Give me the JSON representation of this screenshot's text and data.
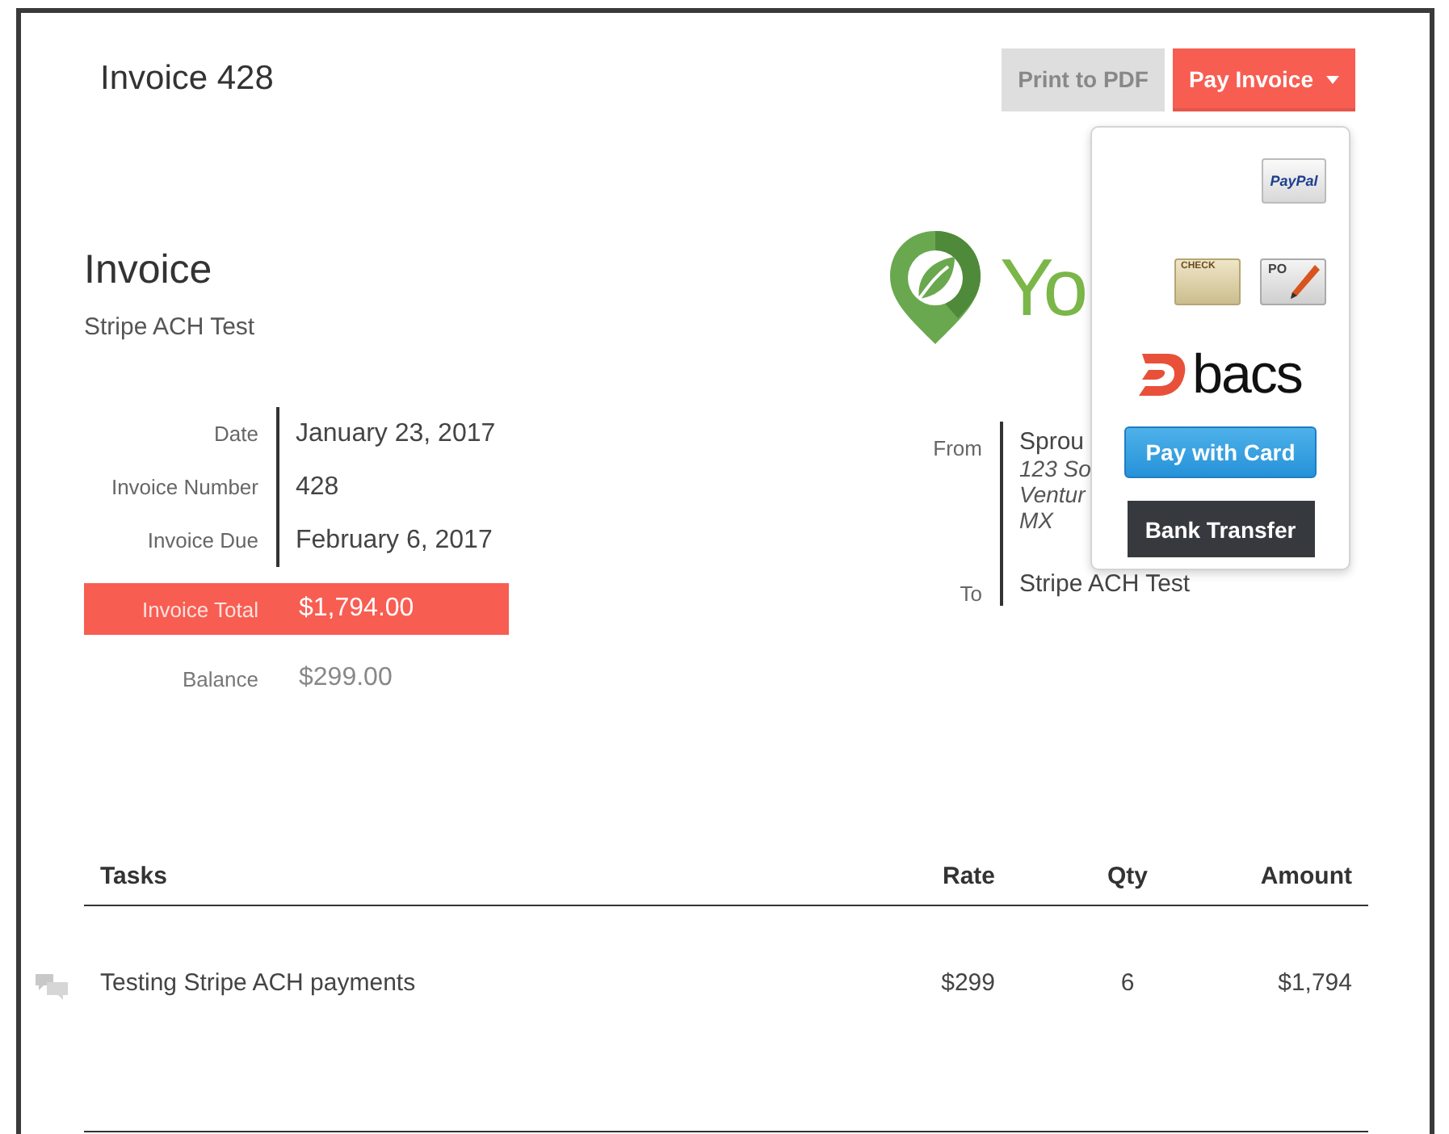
{
  "header": {
    "title": "Invoice 428",
    "buttons": [
      {
        "label": "Print to PDF",
        "kind": "secondary",
        "expanded": false
      },
      {
        "label": "Pay Invoice",
        "kind": "primary",
        "expanded": true
      }
    ]
  },
  "payment_menu": {
    "rows": [
      {
        "options": [
          {
            "kind": "paypal",
            "label": "PayPal"
          }
        ]
      },
      {
        "options": [
          {
            "kind": "check",
            "label": "CHECK"
          },
          {
            "kind": "po",
            "label": "PO"
          }
        ]
      },
      {
        "options": [
          {
            "kind": "bacs",
            "label": "bacs"
          }
        ]
      },
      {
        "options": [
          {
            "kind": "card",
            "label": "Pay with Card"
          }
        ]
      },
      {
        "options": [
          {
            "kind": "transfer",
            "label": "Bank Transfer"
          }
        ]
      }
    ]
  },
  "invoice": {
    "heading": "Invoice",
    "client": "Stripe ACH Test",
    "details": [
      {
        "label": "Date",
        "value": "January 23, 2017"
      },
      {
        "label": "Invoice Number",
        "value": "428"
      },
      {
        "label": "Invoice Due",
        "value": "February 6, 2017"
      }
    ],
    "total": {
      "label": "Invoice Total",
      "value": "$1,794.00"
    },
    "balance": {
      "label": "Balance",
      "value": "$299.00"
    }
  },
  "company": {
    "logo_text": "Yo",
    "parties": [
      {
        "label": "From",
        "name": "Sprou",
        "address": [
          "123 So",
          "Ventur",
          "MX"
        ]
      },
      {
        "label": "To",
        "name": "Stripe ACH Test"
      }
    ]
  },
  "tasks": {
    "columns": [
      "Tasks",
      "Rate",
      "Qty",
      "Amount"
    ],
    "rows": [
      {
        "has_comments": true,
        "cells": [
          "Testing Stripe ACH payments",
          "$299",
          "6",
          "$1,794"
        ]
      }
    ]
  }
}
